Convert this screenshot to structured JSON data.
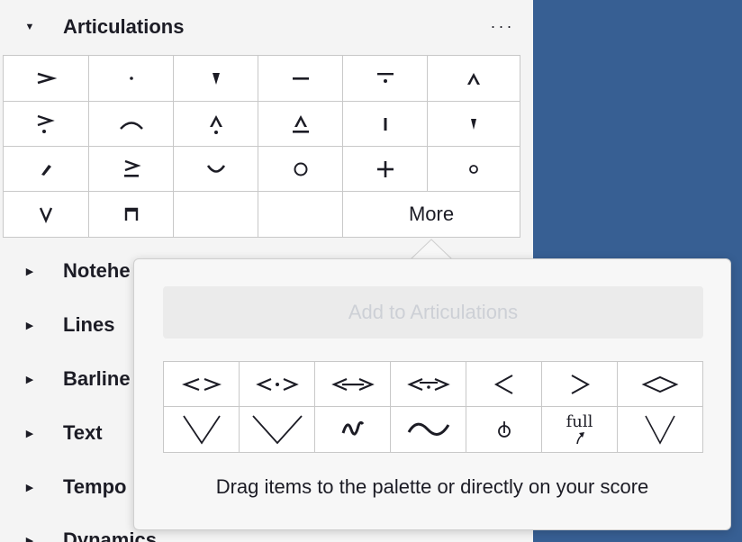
{
  "panel": {
    "expanded_section": {
      "title": "Articulations",
      "toggle": "▼",
      "menu": "···"
    },
    "sections": [
      {
        "title": "Notehe",
        "toggle": "▶"
      },
      {
        "title": "Lines",
        "toggle": "▶"
      },
      {
        "title": "Barline",
        "toggle": "▶"
      },
      {
        "title": "Text",
        "toggle": "▶"
      },
      {
        "title": "Tempo",
        "toggle": "▶"
      },
      {
        "title": "Dynamics",
        "toggle": "▶"
      }
    ],
    "articulation_icons": [
      "accent-icon",
      "staccato-icon",
      "staccatissimo-wedge-icon",
      "tenuto-icon",
      "louré-icon",
      "marcato-icon",
      "accent-staccato-icon",
      "slur-above-icon",
      "marcato-staccato-icon",
      "marcato-tenuto-icon",
      "stroke-icon",
      "staccatissimo-stroke-icon",
      "staccatissimo-icon",
      "tenuto-accent-icon",
      "soft-accent-icon",
      "harmonic-icon",
      "left-hand-pizzicato-icon",
      "snap-pizzicato-icon",
      "up-bow-icon",
      "down-bow-icon"
    ],
    "more_label": "More"
  },
  "popup": {
    "add_button_label": "Add to Articulations",
    "items": [
      "messa-di-voce-icon",
      "messa-di-voce-staccato-icon",
      "messa-di-voce-tenuto-icon",
      "messa-di-voce-louré-icon",
      "crescendo-hairpin-icon",
      "decrescendo-hairpin-icon",
      "open-diamond-icon",
      "wide-v-icon",
      "wider-v-icon",
      "short-wiggle-icon",
      "long-wiggle-icon",
      "thumb-position-icon",
      "bend-full-icon",
      "narrow-v-icon"
    ],
    "bend_label": "full",
    "hint": "Drag items to the palette or directly on your score"
  }
}
